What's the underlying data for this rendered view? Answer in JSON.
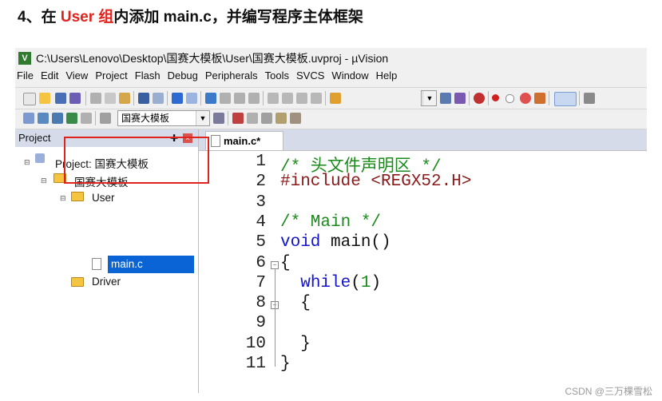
{
  "heading": {
    "number": "4、在 ",
    "highlight": "User 组",
    "rest": "内添加 main.c，并编写程序主体框架"
  },
  "window": {
    "title": "C:\\Users\\Lenovo\\Desktop\\国赛大模板\\User\\国赛大模板.uvproj - µVision"
  },
  "menu": [
    "File",
    "Edit",
    "View",
    "Project",
    "Flash",
    "Debug",
    "Peripherals",
    "Tools",
    "SVCS",
    "Window",
    "Help"
  ],
  "toolbar": {
    "target_combo": "国赛大模板"
  },
  "project_panel": {
    "header": "Project",
    "tree": {
      "project": "Project: 国赛大模板",
      "target": "国赛大模板",
      "group_user": "User",
      "file_main": "main.c",
      "group_driver": "Driver"
    }
  },
  "editor": {
    "tab_label": "main.c*",
    "line_numbers": [
      "1",
      "2",
      "3",
      "4",
      "5",
      "6",
      "7",
      "8",
      "9",
      "10",
      "11"
    ],
    "lines": [
      [
        {
          "t": "/* 头文件声明区 */",
          "c": "cmt"
        }
      ],
      [
        {
          "t": "#include ",
          "c": "pp"
        },
        {
          "t": "<REGX52.H>",
          "c": "pp"
        }
      ],
      [],
      [
        {
          "t": "/* Main */",
          "c": "cmt"
        }
      ],
      [
        {
          "t": "void",
          "c": "kw"
        },
        {
          "t": " main()",
          "c": "plain"
        }
      ],
      [
        {
          "t": "{",
          "c": "plain"
        }
      ],
      [
        {
          "t": "  ",
          "c": "plain"
        },
        {
          "t": "while",
          "c": "kw"
        },
        {
          "t": "(",
          "c": "plain"
        },
        {
          "t": "1",
          "c": "cmt"
        },
        {
          "t": ")",
          "c": "plain"
        }
      ],
      [
        {
          "t": "  {",
          "c": "plain"
        }
      ],
      [],
      [
        {
          "t": "  }",
          "c": "plain"
        }
      ],
      [
        {
          "t": "}",
          "c": "plain"
        }
      ]
    ]
  },
  "watermark": "CSDN @三万棵雪松",
  "colors": {
    "accent_red": "#e0231c",
    "selection": "#0a64d6",
    "comment": "#1a8a1a",
    "keyword": "#1414c8",
    "preprocessor": "#8a1a1a"
  }
}
